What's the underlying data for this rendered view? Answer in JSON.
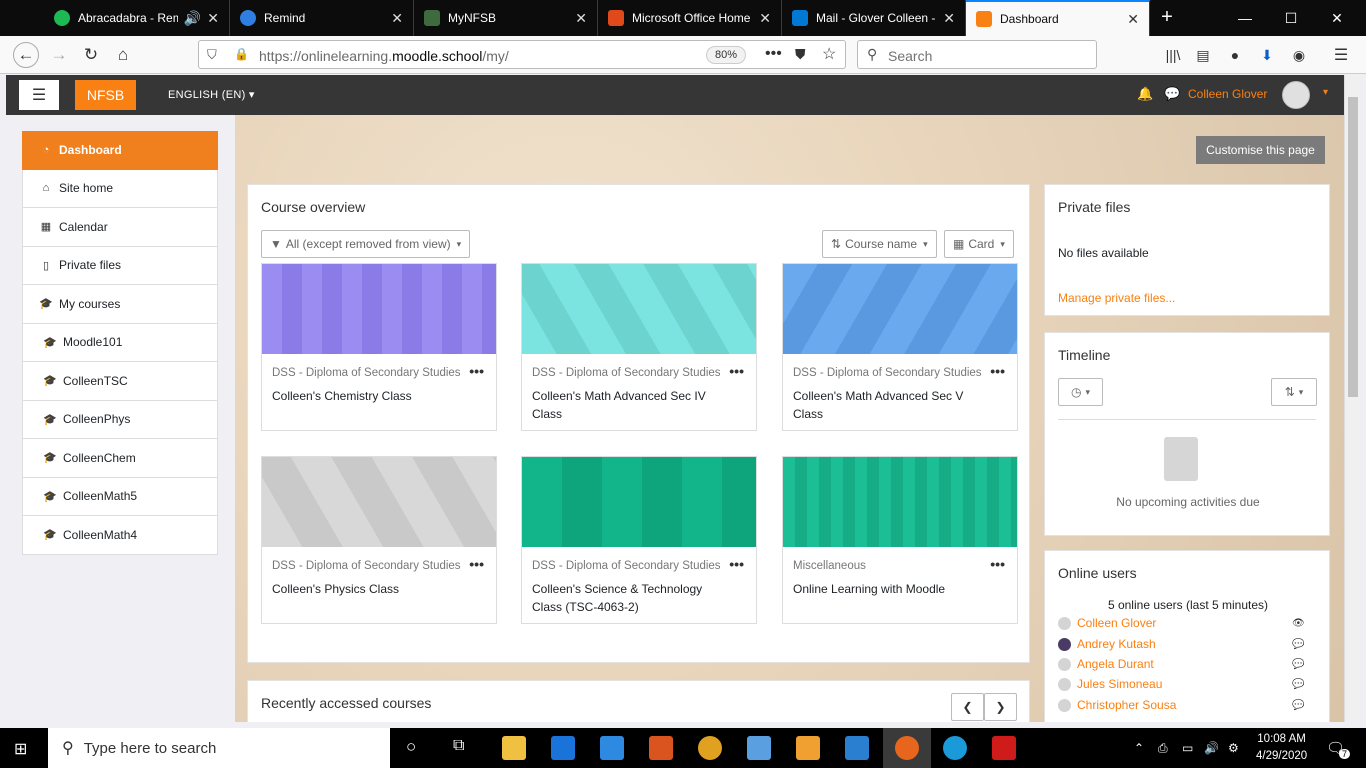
{
  "browser": {
    "tabs": [
      {
        "label": "Abracadabra - Rema",
        "color": "#1db954"
      },
      {
        "label": "Remind",
        "color": "#2f7fe0"
      },
      {
        "label": "MyNFSB",
        "color": "#3d6b3d"
      },
      {
        "label": "Microsoft Office Home",
        "color": "#e04a1a"
      },
      {
        "label": "Mail - Glover Colleen - ",
        "color": "#0078d4"
      },
      {
        "label": "Dashboard",
        "color": "#f98012"
      }
    ],
    "url_prefix": "https://onlinelearning.",
    "url_domain": "moodle.school",
    "url_suffix": "/my/",
    "zoom": "80%",
    "search_placeholder": "Search"
  },
  "header": {
    "brand": "NFSB",
    "language": "ENGLISH (EN)",
    "user_name": "Colleen Glover"
  },
  "sidebar": {
    "items": [
      {
        "label": "Dashboard",
        "icon": "dashboard-icon"
      },
      {
        "label": "Site home",
        "icon": "home-icon"
      },
      {
        "label": "Calendar",
        "icon": "calendar-icon"
      },
      {
        "label": "Private files",
        "icon": "file-icon"
      },
      {
        "label": "My courses",
        "icon": "graduation-cap-icon"
      },
      {
        "label": "Moodle101",
        "icon": "graduation-cap-icon"
      },
      {
        "label": "ColleenTSC",
        "icon": "graduation-cap-icon"
      },
      {
        "label": "ColleenPhys",
        "icon": "graduation-cap-icon"
      },
      {
        "label": "ColleenChem",
        "icon": "graduation-cap-icon"
      },
      {
        "label": "ColleenMath5",
        "icon": "graduation-cap-icon"
      },
      {
        "label": "ColleenMath4",
        "icon": "graduation-cap-icon"
      }
    ]
  },
  "main": {
    "customise_label": "Customise this page",
    "course_overview": {
      "title": "Course overview",
      "filter_label": "All (except removed from view)",
      "sort_label": "Course name",
      "view_label": "Card",
      "courses": [
        {
          "category": "DSS - Diploma of Secondary Studies",
          "name": "Colleen's Chemistry Class",
          "color": "#9b8cf2"
        },
        {
          "category": "DSS - Diploma of Secondary Studies",
          "name": "Colleen's Math Advanced Sec IV Class",
          "color": "#7be3e0"
        },
        {
          "category": "DSS - Diploma of Secondary Studies",
          "name": "Colleen's Math Advanced Sec V Class",
          "color": "#6aa9ee"
        },
        {
          "category": "DSS - Diploma of Secondary Studies",
          "name": "Colleen's Physics Class",
          "color": "#d8d8d8"
        },
        {
          "category": "DSS - Diploma of Secondary Studies",
          "name": "Colleen's Science & Technology Class (TSC-4063-2)",
          "color": "#12b58a"
        },
        {
          "category": "Miscellaneous",
          "name": "Online Learning with Moodle",
          "color": "#1cbf95"
        }
      ]
    },
    "recent": {
      "title": "Recently accessed courses"
    }
  },
  "right": {
    "private_files": {
      "title": "Private files",
      "empty": "No files available",
      "manage_link": "Manage private files..."
    },
    "timeline": {
      "title": "Timeline",
      "empty": "No upcoming activities due"
    },
    "online_users": {
      "title": "Online users",
      "summary": "5 online users (last 5 minutes)",
      "users": [
        "Colleen Glover",
        "Andrey Kutash",
        "Angela Durant",
        "Jules Simoneau",
        "Christopher Sousa"
      ]
    }
  },
  "taskbar": {
    "search_placeholder": "Type here to search",
    "time": "10:08 AM",
    "date": "4/29/2020",
    "notification_count": "7"
  }
}
